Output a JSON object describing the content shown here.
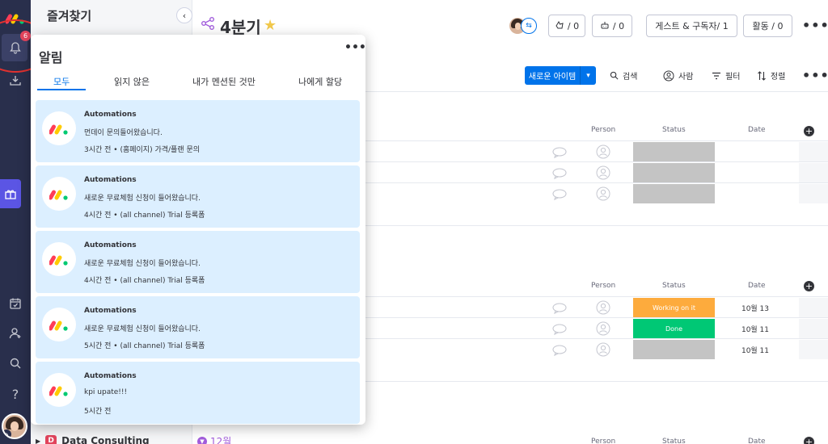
{
  "left_rail": {
    "notification_badge": "6"
  },
  "favorites": {
    "title": "즐겨찾기",
    "board_item": {
      "letter": "D",
      "name": "Data Consulting"
    }
  },
  "board": {
    "title": "4분기",
    "header_buttons": {
      "reactions_count": "/ 0",
      "integrations_count": "/ 0",
      "guests_label": "게스트 & 구독자/ 1",
      "activity_label": "활동 / 0"
    },
    "toolbar": {
      "new_item": "새로운 아이템",
      "search": "검색",
      "person": "사람",
      "filter": "필터",
      "sort": "정렬"
    },
    "columns": {
      "person": "Person",
      "status": "Status",
      "date": "Date"
    },
    "group1_rows": [
      {
        "status": "",
        "date": ""
      },
      {
        "status": "",
        "date": ""
      },
      {
        "status": "",
        "date": ""
      }
    ],
    "group2_rows": [
      {
        "status": "Working on it",
        "date": "10월 13"
      },
      {
        "status": "Done",
        "date": "10월 11"
      },
      {
        "status": "",
        "date": "10월 11"
      }
    ],
    "group3_label": "12월"
  },
  "notifications": {
    "title": "알림",
    "tabs": [
      "모두",
      "읽지 않은",
      "내가 멘션된 것만",
      "나에게 할당"
    ],
    "items": [
      {
        "sender": "Automations",
        "message": "먼데이 문의들어왔습니다.",
        "meta": "3시간 전 • (홈페이지) 가격/플랜 문의"
      },
      {
        "sender": "Automations",
        "message": "새로운 무료체험 신청이 들어왔습니다.",
        "meta": "4시간 전 • (all channel) Trial 등록폼"
      },
      {
        "sender": "Automations",
        "message": "새로운 무료체험 신청이 들어왔습니다.",
        "meta": "4시간 전 • (all channel) Trial 등록폼"
      },
      {
        "sender": "Automations",
        "message": "새로운 무료체험 신청이 들어왔습니다.",
        "meta": "5시간 전 • (all channel) Trial 등록폼"
      },
      {
        "sender": "Automations",
        "message": "kpi upate!!!",
        "meta": "5시간 전"
      }
    ]
  },
  "colors": {
    "rail": "#292f4c",
    "accent": "#0073ea",
    "working_on_it": "#fdab3d",
    "done": "#00c875",
    "empty_status": "#c4c4c4",
    "notif_bg": "#dcefff"
  }
}
